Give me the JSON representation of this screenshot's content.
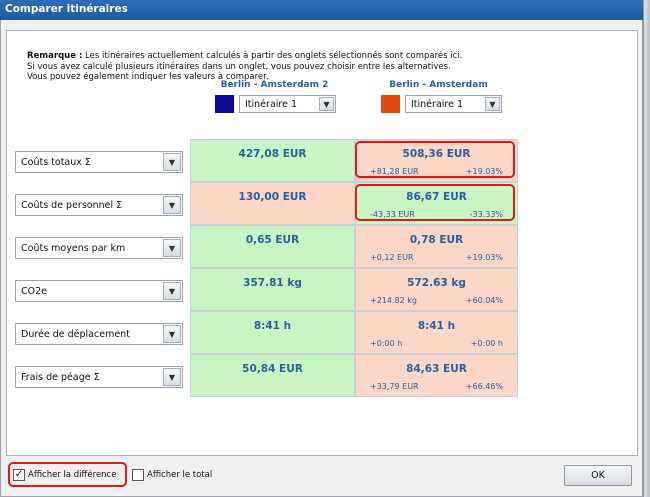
{
  "window": {
    "title": "Comparer itinéraires"
  },
  "remarque": {
    "label": "Remarque :",
    "line1": " Les itinéraires actuellement calculés à partir des onglets sélectionnés sont comparés ici.",
    "line2": "Si vous avez calculé plusieurs itinéraires dans un onglet, vous pouvez choisir entre les alternatives.",
    "line3": "Vous pouvez également indiquer les valeurs à comparer."
  },
  "columns": [
    {
      "title": "Berlin - Amsterdam 2",
      "color": "#0a0a96",
      "selected": "Itinéraire 1"
    },
    {
      "title": "Berlin - Amsterdam",
      "color": "#e04a0a",
      "selected": "Itinéraire 1"
    }
  ],
  "rows": [
    {
      "label": "Coûts totaux Σ",
      "col1": "427,08 EUR",
      "col2": "508,36 EUR",
      "delta_abs": "+81,28 EUR",
      "delta_pct": "+19.03%"
    },
    {
      "label": "Coûts de personnel Σ",
      "col1": "130,00 EUR",
      "col2": "86,67 EUR",
      "delta_abs": "-43,33 EUR",
      "delta_pct": "-33.33%"
    },
    {
      "label": "Coûts moyens par km",
      "col1": "0,65 EUR",
      "col2": "0,78 EUR",
      "delta_abs": "+0,12 EUR",
      "delta_pct": "+19.03%"
    },
    {
      "label": "CO2e",
      "col1": "357.81 kg",
      "col2": "572.63 kg",
      "delta_abs": "+214.82 kg",
      "delta_pct": "+60.04%"
    },
    {
      "label": "Durée de déplacement",
      "col1": "8:41 h",
      "col2": "8:41 h",
      "delta_abs": "+0:00 h",
      "delta_pct": "+0:00 h"
    },
    {
      "label": "Frais de péage Σ",
      "col1": "50,84 EUR",
      "col2": "84,63 EUR",
      "delta_abs": "+33,79 EUR",
      "delta_pct": "+66.46%"
    }
  ],
  "footer": {
    "show_difference": {
      "label": "Afficher la différence",
      "checked": true
    },
    "show_total": {
      "label": "Afficher le total",
      "checked": false
    },
    "ok_label": "OK"
  },
  "colors": {
    "better": "#c8f5c2",
    "worse": "#fcd6c6",
    "highlight": "#e01818",
    "value_text": "#2a5e9e"
  }
}
